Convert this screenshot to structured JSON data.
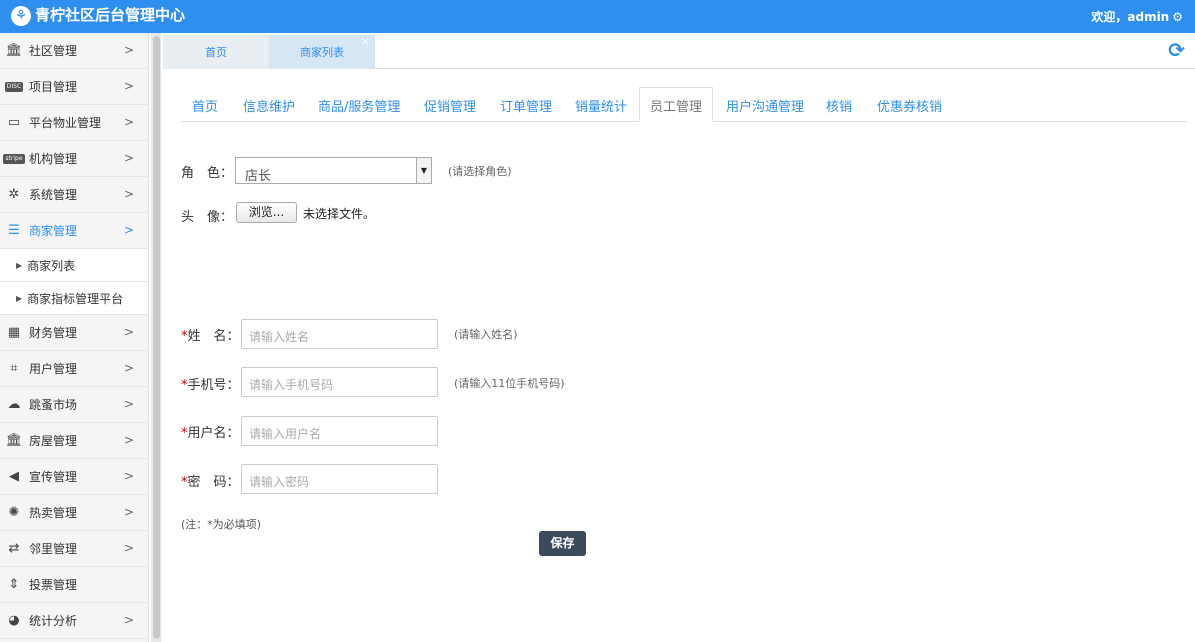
{
  "header": {
    "logo_icon": "community-logo-icon",
    "title": "青柠社区后台管理中心",
    "welcome": "欢迎，admin",
    "settings_icon": "gear-icon",
    "bg_color": "#2f8ff0"
  },
  "sidebar": {
    "items": [
      {
        "label": "社区管理",
        "icon": "bank-icon"
      },
      {
        "label": "项目管理",
        "icon": "discover-card-icon"
      },
      {
        "label": "平台物业管理",
        "icon": "monitor-icon"
      },
      {
        "label": "机构管理",
        "icon": "stripe-icon"
      },
      {
        "label": "系统管理",
        "icon": "pinwheel-icon"
      },
      {
        "label": "商家管理",
        "icon": "list-icon",
        "active": true
      },
      {
        "label": "财务管理",
        "icon": "calculator-icon"
      },
      {
        "label": "用户管理",
        "icon": "crop-icon"
      },
      {
        "label": "跳蚤市场",
        "icon": "cloud-icon"
      },
      {
        "label": "房屋管理",
        "icon": "bank-icon"
      },
      {
        "label": "宣传管理",
        "icon": "speaker-icon"
      },
      {
        "label": "热卖管理",
        "icon": "sun-icon"
      },
      {
        "label": "邻里管理",
        "icon": "retweet-icon"
      },
      {
        "label": "投票管理",
        "icon": "sort-icon"
      },
      {
        "label": "统计分析",
        "icon": "pie-chart-icon"
      }
    ],
    "sub_items": [
      "商家列表",
      "商家指标管理平台"
    ]
  },
  "tabs": {
    "items": [
      "首页",
      "商家列表"
    ],
    "close": "×",
    "refresh_icon": "refresh-icon"
  },
  "subnav": {
    "items": [
      "首页",
      "信息维护",
      "商品/服务管理",
      "促销管理",
      "订单管理",
      "销量统计",
      "员工管理",
      "用户沟通管理",
      "核销",
      "优惠券核销"
    ],
    "active": "员工管理"
  },
  "form": {
    "role_label": "角　色：",
    "role_value": "店长",
    "role_hint": "(请选择角色)",
    "avatar_label": "头　像：",
    "browse_label": "浏览...",
    "no_file": "未选择文件。",
    "required_mark": "*",
    "name_label": "姓　名：",
    "name_placeholder": "请输入姓名",
    "name_hint": "(请输入姓名)",
    "phone_label": "手机号：",
    "phone_placeholder": "请输入手机号码",
    "phone_hint": "(请输入11位手机号码)",
    "username_label": "用户名：",
    "username_placeholder": "请输入用户名",
    "password_label": "密　码：",
    "password_placeholder": "请输入密码",
    "note": "(注：*为必填项)",
    "save_label": "保存"
  }
}
